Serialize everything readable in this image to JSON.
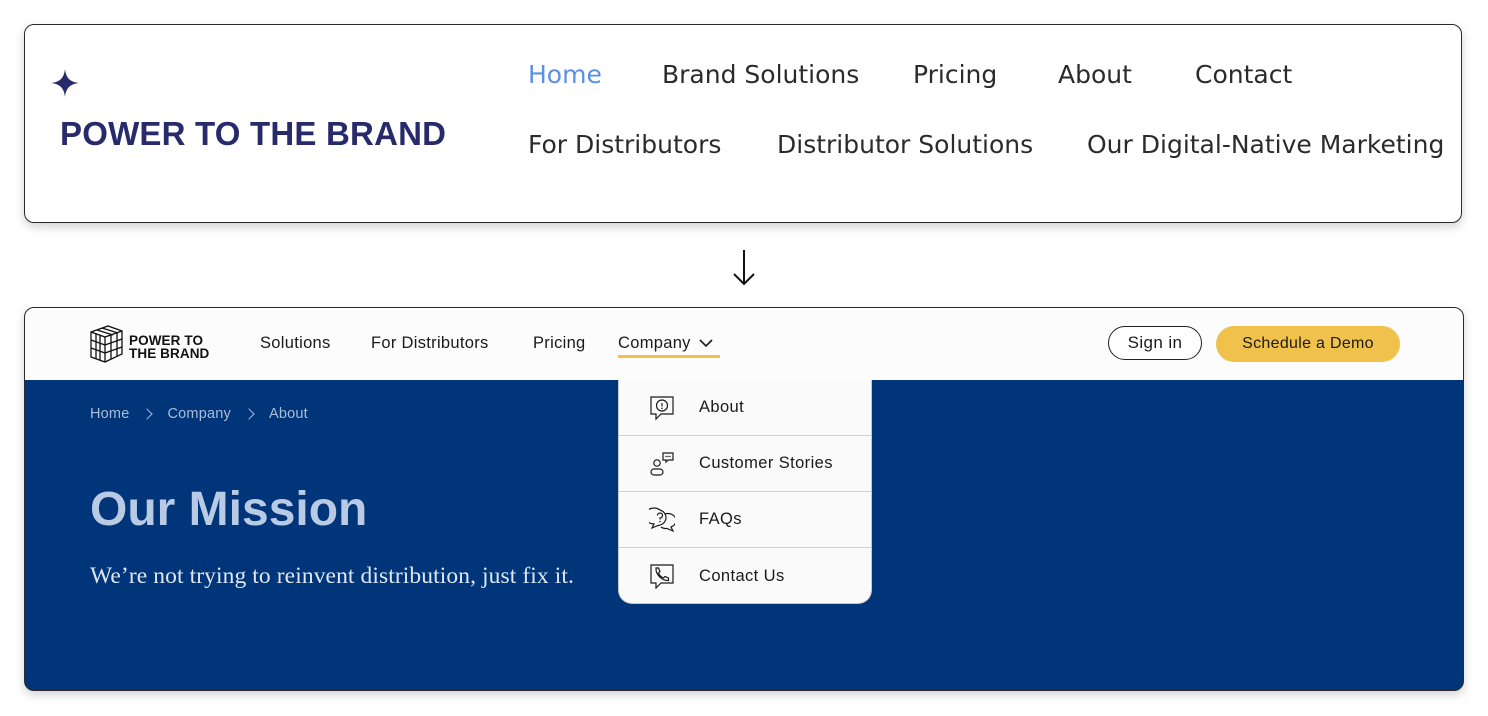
{
  "old_nav": {
    "brand": "POWER TO THE BRAND",
    "links": [
      "Home",
      "Brand Solutions",
      "Pricing",
      "About",
      "Contact",
      "For Distributors",
      "Distributor Solutions",
      "Our Digital-Native Marketing"
    ],
    "active_link": "Home",
    "icon": "sparkle-star-icon"
  },
  "new_site": {
    "logo": {
      "line1": "POWER TO",
      "line2": "THE BRAND",
      "icon": "grid-cube-icon"
    },
    "nav": {
      "solutions": "Solutions",
      "for_distributors": "For Distributors",
      "pricing": "Pricing",
      "company": "Company"
    },
    "sign_in": "Sign in",
    "demo": "Schedule a Demo",
    "breadcrumb": [
      "Home",
      "Company",
      "About"
    ],
    "hero_title": "Our Mission",
    "hero_subtitle": "We’re not trying to reinvent distribution, just fix it.",
    "dropdown": [
      {
        "label": "About",
        "icon": "info-chat-icon"
      },
      {
        "label": "Customer Stories",
        "icon": "people-chat-icon"
      },
      {
        "label": "FAQs",
        "icon": "question-chat-icon"
      },
      {
        "label": "Contact Us",
        "icon": "phone-chat-icon"
      }
    ]
  },
  "colors": {
    "brand_navy": "#272a6b",
    "active_blue": "#5b8fe8",
    "hero_blue": "#003679",
    "accent_yellow": "#f0c24b"
  }
}
